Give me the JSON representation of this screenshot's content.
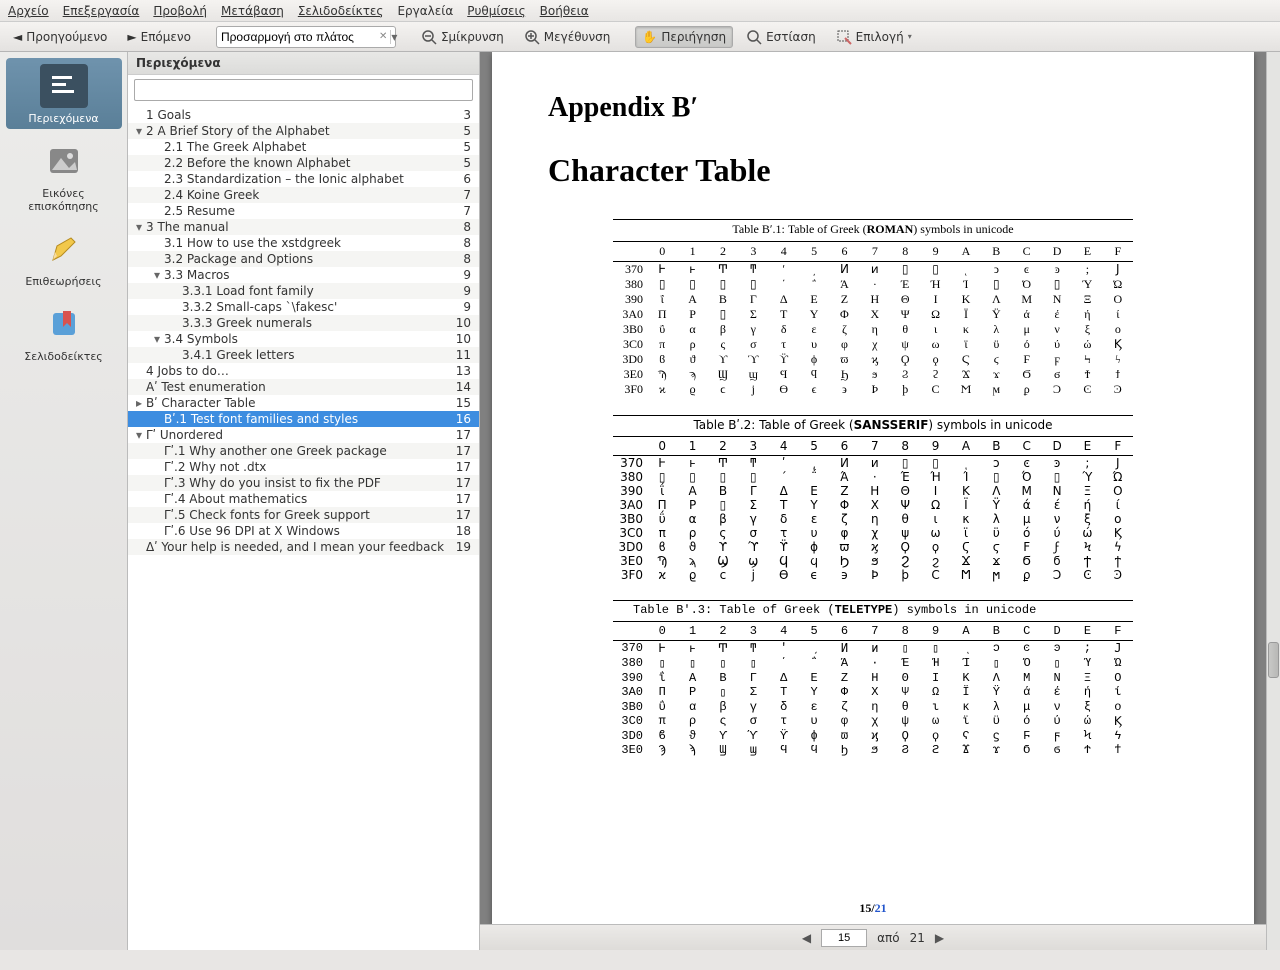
{
  "menu": {
    "file": "Αρχείο",
    "edit": "Επεξεργασία",
    "view": "Προβολή",
    "go": "Μετάβαση",
    "bookmarks": "Σελιδοδείκτες",
    "tools": "Εργαλεία",
    "settings": "Ρυθμίσεις",
    "help": "Βοήθεια"
  },
  "toolbar": {
    "prev": "Προηγούμενο",
    "next": "Επόμενο",
    "zoom_value": "Προσαρμογή στο πλάτος",
    "zoom_out": "Σμίκρυνση",
    "zoom_in": "Μεγέθυνση",
    "browse": "Περιήγηση",
    "focus": "Εστίαση",
    "select": "Επιλογή"
  },
  "side": {
    "contents": "Περιεχόμενα",
    "thumbs": "Εικόνες επισκόπησης",
    "reviews": "Επιθεωρήσεις",
    "bookmarks": "Σελιδοδείκτες"
  },
  "toc": {
    "header": "Περιεχόμενα",
    "items": [
      {
        "ind": 1,
        "arrow": "",
        "label": "1 Goals",
        "page": "3"
      },
      {
        "ind": 1,
        "arrow": "▾",
        "label": "2 A Brief Story of the Alphabet",
        "page": "5"
      },
      {
        "ind": 2,
        "arrow": "",
        "label": "2.1 The Greek Alphabet",
        "page": "5"
      },
      {
        "ind": 2,
        "arrow": "",
        "label": "2.2 Before the known Alphabet",
        "page": "5"
      },
      {
        "ind": 2,
        "arrow": "",
        "label": "2.3 Standardization – the Ionic alphabet",
        "page": "6"
      },
      {
        "ind": 2,
        "arrow": "",
        "label": "2.4 Koine Greek",
        "page": "7"
      },
      {
        "ind": 2,
        "arrow": "",
        "label": "2.5 Resume",
        "page": "7"
      },
      {
        "ind": 1,
        "arrow": "▾",
        "label": "3 The manual",
        "page": "8"
      },
      {
        "ind": 2,
        "arrow": "",
        "label": "3.1 How to use the xstdgreek",
        "page": "8"
      },
      {
        "ind": 2,
        "arrow": "",
        "label": "3.2 Package and Options",
        "page": "8"
      },
      {
        "ind": 2,
        "arrow": "▾",
        "label": "3.3 Macros",
        "page": "9"
      },
      {
        "ind": 3,
        "arrow": "",
        "label": "3.3.1 Load font family",
        "page": "9"
      },
      {
        "ind": 3,
        "arrow": "",
        "label": "3.3.2 Small-caps `\\fakesc'",
        "page": "9"
      },
      {
        "ind": 3,
        "arrow": "",
        "label": "3.3.3 Greek numerals",
        "page": "10"
      },
      {
        "ind": 2,
        "arrow": "▾",
        "label": "3.4 Symbols",
        "page": "10"
      },
      {
        "ind": 3,
        "arrow": "",
        "label": "3.4.1 Greek letters",
        "page": "11"
      },
      {
        "ind": 1,
        "arrow": "",
        "label": "4 Jobs to do…",
        "page": "13"
      },
      {
        "ind": 1,
        "arrow": "",
        "label": "Αʹ Test enumeration",
        "page": "14"
      },
      {
        "ind": 1,
        "arrow": "▸",
        "label": "Βʹ Character Table",
        "page": "15"
      },
      {
        "ind": 2,
        "arrow": "",
        "label": "Βʹ.1 Test font families and styles",
        "page": "16",
        "sel": true
      },
      {
        "ind": 1,
        "arrow": "▾",
        "label": "Γʹ Unordered",
        "page": "17"
      },
      {
        "ind": 2,
        "arrow": "",
        "label": "Γʹ.1 Why another one Greek package",
        "page": "17"
      },
      {
        "ind": 2,
        "arrow": "",
        "label": "Γʹ.2 Why not .dtx",
        "page": "17"
      },
      {
        "ind": 2,
        "arrow": "",
        "label": "Γʹ.3 Why do you insist to fix the PDF",
        "page": "17"
      },
      {
        "ind": 2,
        "arrow": "",
        "label": "Γʹ.4 About mathematics",
        "page": "17"
      },
      {
        "ind": 2,
        "arrow": "",
        "label": "Γʹ.5 Check fonts for Greek support",
        "page": "17"
      },
      {
        "ind": 2,
        "arrow": "",
        "label": "Γʹ.6 Use 96 DPI at X Windows",
        "page": "18"
      },
      {
        "ind": 1,
        "arrow": "",
        "label": "Δʹ Your help is needed, and I mean your feedback",
        "page": "19"
      }
    ]
  },
  "doc": {
    "appendix": "Appendix Βʹ",
    "title": "Character Table",
    "t1": {
      "cap_pre": "Table Βʹ.1: Table of Greek (",
      "cap_b": "ROMAN",
      "cap_post": ") symbols in unicode"
    },
    "t2": {
      "cap_pre": "Table Βʹ.2: Table of Greek (",
      "cap_b": "SANSSERIF",
      "cap_post": ") symbols in unicode"
    },
    "t3": {
      "cap_pre": "Table Βʹ.3: Table of Greek (",
      "cap_b": "TELETYPE",
      "cap_post": ") symbols in unicode"
    },
    "cols": [
      "0",
      "1",
      "2",
      "3",
      "4",
      "5",
      "6",
      "7",
      "8",
      "9",
      "A",
      "B",
      "C",
      "D",
      "E",
      "F"
    ],
    "rows": [
      "370",
      "380",
      "390",
      "3A0",
      "3B0",
      "3C0",
      "3D0",
      "3E0",
      "3F0"
    ],
    "rows3": [
      "370",
      "380",
      "390",
      "3A0",
      "3B0",
      "3C0",
      "3D0",
      "3E0"
    ],
    "grid": [
      [
        "Ͱ",
        "ͱ",
        "Ͳ",
        "ͳ",
        "ʹ",
        "͵",
        "Ͷ",
        "ͷ",
        "▯",
        "▯",
        "ͺ",
        "ͻ",
        "ͼ",
        "ͽ",
        ";",
        "Ϳ"
      ],
      [
        "▯",
        "▯",
        "▯",
        "▯",
        "΄",
        "΅",
        "Ά",
        "·",
        "Έ",
        "Ή",
        "Ί",
        "▯",
        "Ό",
        "▯",
        "Ύ",
        "Ώ"
      ],
      [
        "ΐ",
        "Α",
        "Β",
        "Γ",
        "Δ",
        "Ε",
        "Ζ",
        "Η",
        "Θ",
        "Ι",
        "Κ",
        "Λ",
        "Μ",
        "Ν",
        "Ξ",
        "Ο"
      ],
      [
        "Π",
        "Ρ",
        "▯",
        "Σ",
        "Τ",
        "Υ",
        "Φ",
        "Χ",
        "Ψ",
        "Ω",
        "Ϊ",
        "Ϋ",
        "ά",
        "έ",
        "ή",
        "ί"
      ],
      [
        "ΰ",
        "α",
        "β",
        "γ",
        "δ",
        "ε",
        "ζ",
        "η",
        "θ",
        "ι",
        "κ",
        "λ",
        "μ",
        "ν",
        "ξ",
        "ο"
      ],
      [
        "π",
        "ρ",
        "ς",
        "σ",
        "τ",
        "υ",
        "φ",
        "χ",
        "ψ",
        "ω",
        "ϊ",
        "ϋ",
        "ό",
        "ύ",
        "ώ",
        "Ϗ"
      ],
      [
        "ϐ",
        "ϑ",
        "ϒ",
        "ϓ",
        "ϔ",
        "ϕ",
        "ϖ",
        "ϗ",
        "Ϙ",
        "ϙ",
        "Ϛ",
        "ϛ",
        "Ϝ",
        "ϝ",
        "Ϟ",
        "ϟ"
      ],
      [
        "Ϡ",
        "ϡ",
        "Ϣ",
        "ϣ",
        "Ϥ",
        "ϥ",
        "Ϧ",
        "ϧ",
        "Ϩ",
        "ϩ",
        "Ϫ",
        "ϫ",
        "Ϭ",
        "ϭ",
        "Ϯ",
        "ϯ"
      ],
      [
        "ϰ",
        "ϱ",
        "ϲ",
        "ϳ",
        "ϴ",
        "ϵ",
        "϶",
        "Ϸ",
        "ϸ",
        "Ϲ",
        "Ϻ",
        "ϻ",
        "ϼ",
        "Ͻ",
        "Ͼ",
        "Ͽ"
      ]
    ],
    "page_cur": "15",
    "page_tot": "21"
  },
  "pagebar": {
    "cur": "15",
    "sep": "από",
    "total": "21"
  }
}
